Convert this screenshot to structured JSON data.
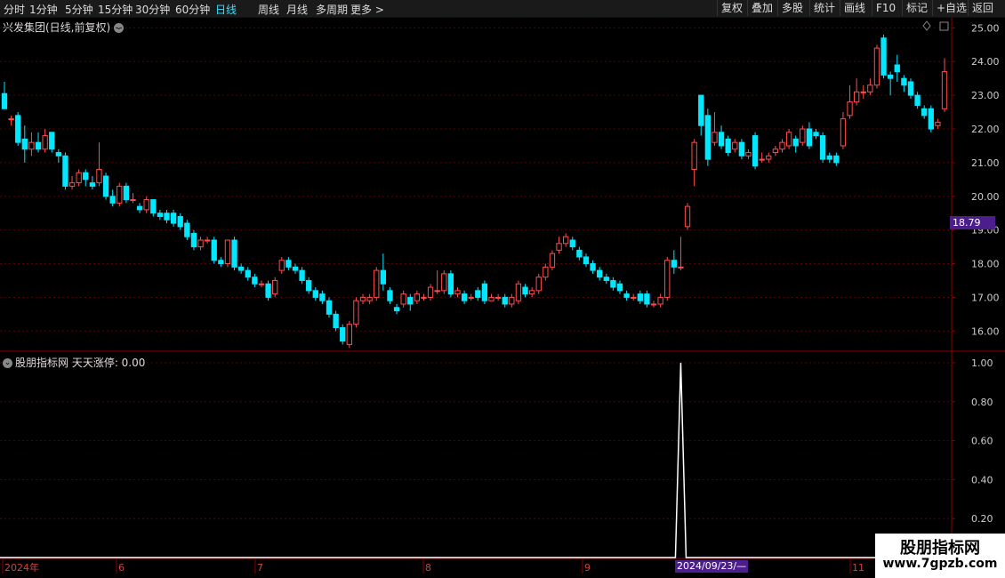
{
  "toolbar": {
    "timeframes": [
      "分时",
      "1分钟",
      "5分钟",
      "15分钟",
      "30分钟",
      "60分钟",
      "日线",
      "周线",
      "月线",
      "多周期",
      "更多 >"
    ],
    "active": "日线",
    "buttons": [
      "复权",
      "叠加",
      "多股",
      "统计",
      "画线",
      "F10",
      "标记",
      "+自选",
      "返回"
    ]
  },
  "chart_title": "兴发集团(日线,前复权)",
  "indicator_title": "股朋指标网  天天涨停: 0.00",
  "price_axis": [
    "25.00",
    "24.00",
    "23.00",
    "22.00",
    "21.00",
    "20.00",
    "19.00",
    "18.00",
    "17.00",
    "16.00"
  ],
  "current_price": "18.79",
  "indicator_axis": [
    "1.00",
    "0.80",
    "0.60",
    "0.40",
    "0.20"
  ],
  "time_axis": [
    "2024年",
    "6",
    "7",
    "8",
    "9",
    "11"
  ],
  "cursor_date": "2024/09/23/—",
  "watermark": {
    "line1": "股朋指标网",
    "line2": "www.7gpzb.com"
  },
  "colors": {
    "up": "#ff4d4d",
    "down": "#00e8ff",
    "grid": "#5a0000",
    "border": "#8b0000",
    "accent": "#4b1e8c"
  },
  "chart_data": {
    "type": "candlestick",
    "ylim": [
      15.4,
      25.3
    ],
    "candles": [
      [
        23.05,
        22.6,
        23.4,
        22.6
      ],
      [
        22.3,
        22.3,
        22.4,
        22.1
      ],
      [
        22.4,
        21.6,
        22.5,
        21.5
      ],
      [
        21.7,
        21.4,
        22.1,
        21.0
      ],
      [
        21.4,
        21.6,
        21.9,
        21.2
      ],
      [
        21.6,
        21.4,
        21.9,
        21.3
      ],
      [
        21.4,
        21.8,
        22.0,
        21.3
      ],
      [
        21.9,
        21.4,
        21.9,
        21.3
      ],
      [
        21.3,
        21.2,
        21.4,
        21.0
      ],
      [
        21.2,
        20.3,
        21.3,
        20.2
      ],
      [
        20.3,
        20.4,
        20.6,
        20.2
      ],
      [
        20.4,
        20.7,
        20.8,
        20.3
      ],
      [
        20.7,
        20.5,
        20.8,
        20.3
      ],
      [
        20.4,
        20.3,
        20.6,
        20.2
      ],
      [
        20.4,
        20.8,
        21.6,
        20.3
      ],
      [
        20.6,
        20.0,
        20.7,
        19.9
      ],
      [
        20.0,
        19.8,
        20.2,
        19.7
      ],
      [
        19.8,
        20.3,
        20.4,
        19.7
      ],
      [
        20.3,
        19.9,
        20.4,
        19.8
      ],
      [
        19.9,
        19.9,
        20.1,
        19.8
      ],
      [
        19.7,
        19.6,
        19.8,
        19.5
      ],
      [
        19.6,
        19.9,
        20.0,
        19.5
      ],
      [
        19.9,
        19.5,
        19.9,
        19.4
      ],
      [
        19.5,
        19.4,
        19.6,
        19.3
      ],
      [
        19.5,
        19.3,
        19.6,
        19.2
      ],
      [
        19.5,
        19.2,
        19.6,
        19.1
      ],
      [
        19.4,
        19.1,
        19.5,
        19.0
      ],
      [
        19.2,
        18.8,
        19.3,
        18.7
      ],
      [
        18.9,
        18.5,
        19.0,
        18.4
      ],
      [
        18.5,
        18.7,
        18.8,
        18.4
      ],
      [
        18.7,
        18.7,
        18.8,
        18.6
      ],
      [
        18.7,
        18.1,
        18.8,
        18.0
      ],
      [
        18.1,
        18.0,
        18.2,
        17.9
      ],
      [
        18.0,
        18.7,
        18.7,
        17.9
      ],
      [
        18.7,
        17.9,
        18.8,
        17.8
      ],
      [
        17.9,
        17.8,
        18.0,
        17.7
      ],
      [
        17.8,
        17.6,
        17.9,
        17.5
      ],
      [
        17.6,
        17.4,
        17.7,
        17.3
      ],
      [
        17.4,
        17.4,
        17.5,
        17.3
      ],
      [
        17.4,
        17.0,
        17.5,
        16.9
      ],
      [
        17.1,
        17.5,
        17.6,
        17.0
      ],
      [
        17.8,
        18.1,
        18.2,
        17.7
      ],
      [
        18.1,
        17.9,
        18.2,
        17.8
      ],
      [
        17.9,
        17.8,
        18.0,
        17.7
      ],
      [
        17.8,
        17.5,
        17.9,
        17.4
      ],
      [
        17.5,
        17.2,
        17.6,
        17.1
      ],
      [
        17.2,
        17.0,
        17.3,
        16.9
      ],
      [
        17.1,
        16.9,
        17.2,
        16.8
      ],
      [
        16.9,
        16.5,
        17.0,
        16.4
      ],
      [
        16.5,
        16.1,
        16.6,
        16.0
      ],
      [
        16.1,
        15.7,
        16.2,
        15.6
      ],
      [
        15.6,
        16.2,
        16.3,
        15.5
      ],
      [
        16.2,
        16.9,
        17.0,
        16.1
      ],
      [
        16.9,
        17.0,
        17.1,
        16.8
      ],
      [
        16.9,
        17.0,
        17.1,
        16.8
      ],
      [
        17.0,
        17.8,
        17.9,
        16.9
      ],
      [
        17.8,
        17.4,
        18.3,
        17.2
      ],
      [
        17.2,
        16.9,
        17.3,
        16.8
      ],
      [
        16.7,
        16.6,
        16.8,
        16.5
      ],
      [
        16.8,
        17.1,
        17.2,
        16.7
      ],
      [
        17.0,
        16.8,
        17.1,
        16.6
      ],
      [
        16.9,
        17.1,
        17.2,
        16.8
      ],
      [
        17.0,
        17.0,
        17.1,
        16.9
      ],
      [
        17.0,
        17.3,
        17.4,
        16.9
      ],
      [
        17.2,
        17.2,
        17.8,
        17.1
      ],
      [
        17.2,
        17.7,
        17.8,
        17.1
      ],
      [
        17.7,
        17.1,
        17.8,
        17.0
      ],
      [
        17.1,
        17.2,
        17.3,
        17.0
      ],
      [
        17.1,
        16.9,
        17.2,
        16.8
      ],
      [
        17.0,
        17.0,
        17.1,
        16.9
      ],
      [
        17.2,
        17.0,
        17.3,
        16.9
      ],
      [
        17.4,
        16.9,
        17.5,
        16.8
      ],
      [
        16.9,
        17.0,
        17.1,
        16.9
      ],
      [
        17.0,
        17.0,
        17.1,
        16.9
      ],
      [
        17.0,
        16.8,
        17.1,
        16.7
      ],
      [
        16.8,
        17.0,
        17.1,
        16.7
      ],
      [
        16.9,
        17.4,
        17.5,
        16.8
      ],
      [
        17.3,
        17.1,
        17.4,
        17.0
      ],
      [
        17.1,
        17.2,
        17.3,
        17.0
      ],
      [
        17.2,
        17.6,
        17.7,
        17.1
      ],
      [
        17.6,
        17.9,
        18.0,
        17.5
      ],
      [
        17.9,
        18.3,
        18.4,
        17.8
      ],
      [
        18.4,
        18.6,
        18.8,
        18.3
      ],
      [
        18.6,
        18.8,
        18.9,
        18.5
      ],
      [
        18.7,
        18.5,
        18.8,
        18.4
      ],
      [
        18.4,
        18.2,
        18.5,
        18.1
      ],
      [
        18.2,
        18.0,
        18.3,
        17.9
      ],
      [
        18.0,
        17.8,
        18.1,
        17.7
      ],
      [
        17.8,
        17.6,
        17.9,
        17.5
      ],
      [
        17.6,
        17.5,
        17.7,
        17.4
      ],
      [
        17.5,
        17.3,
        17.6,
        17.2
      ],
      [
        17.4,
        17.2,
        17.5,
        17.1
      ],
      [
        17.1,
        17.0,
        17.2,
        16.9
      ],
      [
        17.0,
        17.0,
        17.1,
        16.9
      ],
      [
        17.1,
        16.9,
        17.2,
        16.8
      ],
      [
        17.1,
        16.8,
        17.2,
        16.7
      ],
      [
        16.8,
        16.8,
        16.9,
        16.7
      ],
      [
        16.8,
        17.0,
        17.1,
        16.7
      ],
      [
        17.0,
        18.1,
        18.2,
        16.9
      ],
      [
        18.1,
        17.9,
        18.4,
        17.7
      ],
      [
        17.9,
        17.9,
        18.8,
        17.8
      ],
      [
        19.1,
        19.7,
        19.8,
        19.0
      ],
      [
        20.8,
        21.6,
        21.7,
        20.3
      ],
      [
        23.0,
        22.1,
        23.0,
        21.8
      ],
      [
        22.4,
        21.1,
        22.6,
        20.9
      ],
      [
        21.6,
        21.9,
        22.5,
        21.5
      ],
      [
        21.9,
        21.5,
        22.1,
        21.4
      ],
      [
        21.7,
        21.3,
        21.8,
        21.2
      ],
      [
        21.4,
        21.6,
        21.7,
        21.3
      ],
      [
        21.6,
        21.2,
        21.7,
        21.1
      ],
      [
        21.2,
        21.3,
        21.4,
        21.1
      ],
      [
        21.8,
        20.9,
        21.9,
        20.8
      ],
      [
        21.1,
        21.1,
        21.3,
        21.0
      ],
      [
        21.1,
        21.2,
        21.3,
        21.0
      ],
      [
        21.3,
        21.4,
        21.5,
        21.2
      ],
      [
        21.4,
        21.6,
        21.7,
        21.3
      ],
      [
        21.5,
        21.9,
        22.0,
        21.4
      ],
      [
        21.7,
        21.5,
        21.8,
        21.3
      ],
      [
        21.6,
        22.0,
        22.1,
        21.5
      ],
      [
        22.0,
        21.5,
        22.2,
        21.4
      ],
      [
        21.9,
        21.8,
        22.0,
        21.7
      ],
      [
        21.8,
        21.1,
        21.9,
        21.0
      ],
      [
        21.2,
        21.1,
        21.3,
        21.0
      ],
      [
        21.2,
        21.0,
        21.3,
        20.9
      ],
      [
        21.5,
        22.3,
        22.5,
        21.4
      ],
      [
        22.4,
        22.8,
        23.3,
        22.3
      ],
      [
        22.8,
        23.1,
        23.5,
        22.7
      ],
      [
        23.1,
        23.1,
        23.3,
        22.9
      ],
      [
        23.1,
        23.3,
        23.5,
        23.0
      ],
      [
        23.3,
        24.4,
        24.5,
        23.2
      ],
      [
        24.7,
        23.6,
        24.8,
        23.5
      ],
      [
        23.6,
        23.5,
        23.7,
        23.0
      ],
      [
        23.9,
        23.7,
        24.2,
        23.4
      ],
      [
        23.5,
        23.3,
        23.6,
        23.1
      ],
      [
        23.4,
        23.0,
        23.5,
        22.9
      ],
      [
        23.0,
        22.7,
        23.1,
        22.6
      ],
      [
        22.6,
        22.4,
        22.7,
        22.3
      ],
      [
        22.6,
        22.0,
        22.7,
        21.9
      ],
      [
        22.1,
        22.2,
        22.3,
        22.0
      ],
      [
        22.6,
        23.7,
        24.1,
        22.5
      ]
    ],
    "indicator": {
      "name": "天天涨停",
      "value": "0.00",
      "spike_index": 100,
      "spike_value": 1.0,
      "ylim": [
        0,
        1.05
      ]
    }
  }
}
